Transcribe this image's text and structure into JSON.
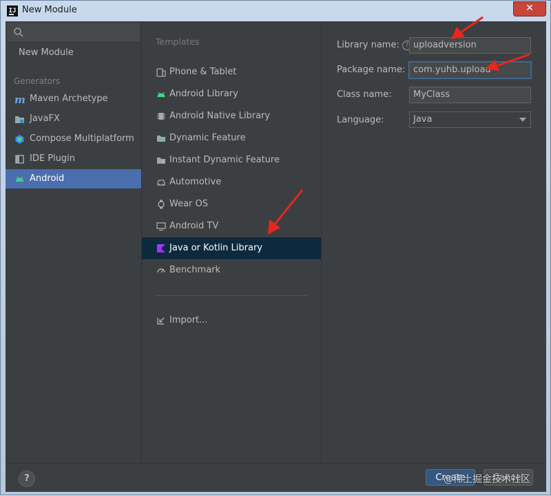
{
  "window": {
    "title": "New Module",
    "app_icon": "intellij-icon",
    "close_glyph": "✕"
  },
  "left": {
    "search": {
      "placeholder": "",
      "icon": "search-icon"
    },
    "new_module": "New Module",
    "generators_label": "Generators",
    "items": [
      {
        "label": "Maven Archetype",
        "icon": "maven-icon"
      },
      {
        "label": "JavaFX",
        "icon": "folder-icon"
      },
      {
        "label": "Compose Multiplatform",
        "icon": "compose-icon"
      },
      {
        "label": "IDE Plugin",
        "icon": "plugin-icon"
      },
      {
        "label": "Android",
        "icon": "android-icon",
        "selected": true
      }
    ]
  },
  "templates": {
    "header": "Templates",
    "items": [
      {
        "label": "Phone & Tablet",
        "icon": "phone-icon"
      },
      {
        "label": "Android Library",
        "icon": "android-icon"
      },
      {
        "label": "Android Native Library",
        "icon": "chip-icon"
      },
      {
        "label": "Dynamic Feature",
        "icon": "folder-icon"
      },
      {
        "label": "Instant Dynamic Feature",
        "icon": "folder-lightning-icon"
      },
      {
        "label": "Automotive",
        "icon": "car-icon"
      },
      {
        "label": "Wear OS",
        "icon": "watch-icon"
      },
      {
        "label": "Android TV",
        "icon": "tv-icon"
      },
      {
        "label": "Java or Kotlin Library",
        "icon": "kotlin-icon",
        "selected": true
      },
      {
        "label": "Benchmark",
        "icon": "gauge-icon"
      }
    ],
    "import": {
      "label": "Import...",
      "icon": "import-icon"
    }
  },
  "form": {
    "library_name": {
      "label": "Library name:",
      "value": "uploadversion"
    },
    "package_name": {
      "label": "Package name:",
      "value": "com.yuhb.upload"
    },
    "class_name": {
      "label": "Class name:",
      "value": "MyClass"
    },
    "language": {
      "label": "Language:",
      "value": "Java"
    }
  },
  "buttons": {
    "help": "?",
    "create": "Create",
    "cancel": "Cancel"
  },
  "watermark": "@稀土掘金技术社区",
  "colors": {
    "accent": "#4b6eaf",
    "selected_template": "#0d293e",
    "arrow": "#e8261e",
    "panel": "#3c3f41"
  }
}
